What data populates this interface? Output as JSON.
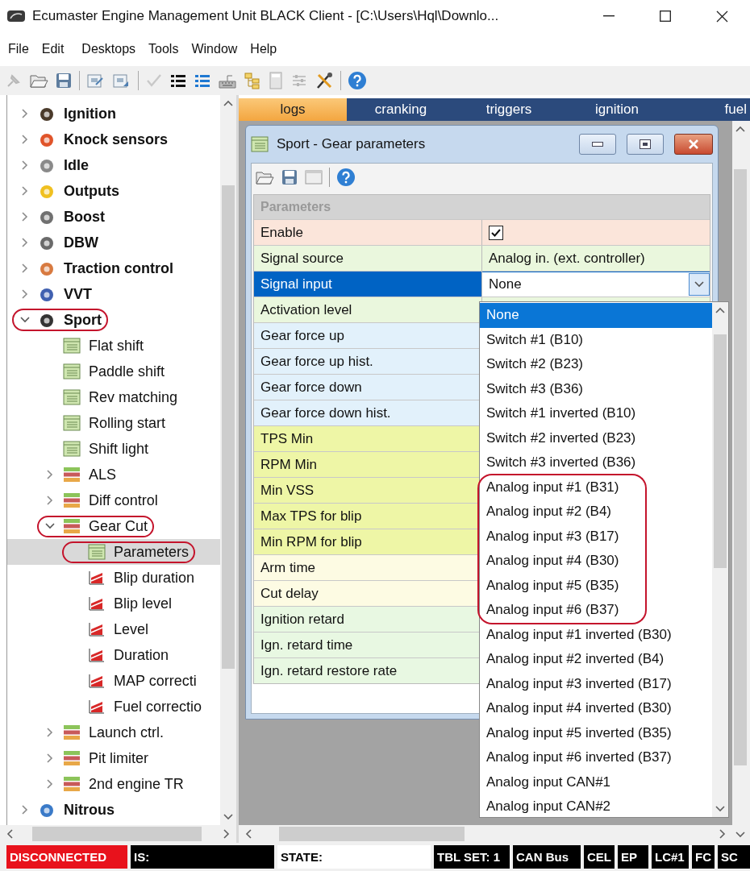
{
  "window": {
    "title": "Ecumaster Engine Management Unit BLACK Client - [C:\\Users\\Hql\\Downlo..."
  },
  "menu": [
    "File",
    "Edit",
    "Desktops",
    "Tools",
    "Window",
    "Help"
  ],
  "tree": {
    "items": [
      {
        "label": "Ignition",
        "kind": "category",
        "expanded": false,
        "selected": false,
        "circled": false
      },
      {
        "label": "Knock sensors",
        "kind": "category",
        "expanded": false,
        "selected": false,
        "circled": false
      },
      {
        "label": "Idle",
        "kind": "category",
        "expanded": false,
        "selected": false,
        "circled": false
      },
      {
        "label": "Outputs",
        "kind": "category",
        "expanded": false,
        "selected": false,
        "circled": false
      },
      {
        "label": "Boost",
        "kind": "category",
        "expanded": false,
        "selected": false,
        "circled": false
      },
      {
        "label": "DBW",
        "kind": "category",
        "expanded": false,
        "selected": false,
        "circled": false
      },
      {
        "label": "Traction control",
        "kind": "category",
        "expanded": false,
        "selected": false,
        "circled": false
      },
      {
        "label": "VVT",
        "kind": "category",
        "expanded": false,
        "selected": false,
        "circled": false
      },
      {
        "label": "Sport",
        "kind": "category",
        "expanded": true,
        "selected": false,
        "circled": true,
        "children": [
          {
            "label": "Flat shift",
            "kind": "table",
            "selected": false,
            "circled": false
          },
          {
            "label": "Paddle shift",
            "kind": "table",
            "selected": false,
            "circled": false
          },
          {
            "label": "Rev matching",
            "kind": "table",
            "selected": false,
            "circled": false
          },
          {
            "label": "Rolling start",
            "kind": "table",
            "selected": false,
            "circled": false
          },
          {
            "label": "Shift light",
            "kind": "table",
            "selected": false,
            "circled": false
          },
          {
            "label": "ALS",
            "kind": "group",
            "expanded": false,
            "selected": false,
            "circled": false
          },
          {
            "label": "Diff control",
            "kind": "group",
            "expanded": false,
            "selected": false,
            "circled": false
          },
          {
            "label": "Gear Cut",
            "kind": "group",
            "expanded": true,
            "selected": false,
            "circled": true,
            "children": [
              {
                "label": "Parameters",
                "kind": "table",
                "selected": true,
                "circled": true
              },
              {
                "label": "Blip duration",
                "kind": "map",
                "selected": false,
                "circled": false
              },
              {
                "label": "Blip level",
                "kind": "map",
                "selected": false,
                "circled": false
              },
              {
                "label": "Level",
                "kind": "map",
                "selected": false,
                "circled": false
              },
              {
                "label": "Duration",
                "kind": "map",
                "selected": false,
                "circled": false
              },
              {
                "label": "MAP correcti",
                "kind": "map",
                "selected": false,
                "circled": false
              },
              {
                "label": "Fuel correctio",
                "kind": "map",
                "selected": false,
                "circled": false
              }
            ]
          },
          {
            "label": "Launch ctrl.",
            "kind": "group",
            "expanded": false,
            "selected": false,
            "circled": false
          },
          {
            "label": "Pit limiter",
            "kind": "group",
            "expanded": false,
            "selected": false,
            "circled": false
          },
          {
            "label": "2nd engine TR",
            "kind": "group",
            "expanded": false,
            "selected": false,
            "circled": false
          }
        ]
      },
      {
        "label": "Nitrous",
        "kind": "category",
        "expanded": false,
        "selected": false,
        "circled": false
      }
    ]
  },
  "tabs": [
    {
      "label": "logs",
      "selected": true
    },
    {
      "label": "cranking",
      "selected": false
    },
    {
      "label": "triggers",
      "selected": false
    },
    {
      "label": "ignition",
      "selected": false
    },
    {
      "label": "fuel",
      "selected": false
    }
  ],
  "param_window": {
    "title": "Sport - Gear parameters",
    "section": "Parameters",
    "rows": [
      {
        "label": "Enable",
        "kind": "checkbox",
        "checked": true,
        "color": "#fbe5da",
        "selected": false
      },
      {
        "label": "Signal source",
        "kind": "text",
        "value": "Analog in. (ext. controller)",
        "color": "#eaf7dd",
        "selected": false
      },
      {
        "label": "Signal input",
        "kind": "dropdown",
        "value": "None",
        "selected": true
      },
      {
        "label": "Activation level",
        "kind": "empty",
        "color": "#eaf7dd",
        "selected": false
      },
      {
        "label": "Gear force up",
        "kind": "empty",
        "color": "#e2f1fb",
        "selected": false
      },
      {
        "label": "Gear force up hist.",
        "kind": "empty",
        "color": "#e2f1fb",
        "selected": false
      },
      {
        "label": "Gear force down",
        "kind": "empty",
        "color": "#e2f1fb",
        "selected": false
      },
      {
        "label": "Gear force down hist.",
        "kind": "empty",
        "color": "#e2f1fb",
        "selected": false
      },
      {
        "label": "TPS Min",
        "kind": "empty",
        "color": "#eef6a6",
        "selected": false
      },
      {
        "label": "RPM Min",
        "kind": "empty",
        "color": "#eef6a6",
        "selected": false
      },
      {
        "label": "Min VSS",
        "kind": "empty",
        "color": "#eef6a6",
        "selected": false
      },
      {
        "label": "Max TPS for blip",
        "kind": "empty",
        "color": "#eef6a6",
        "selected": false
      },
      {
        "label": "Min RPM for blip",
        "kind": "empty",
        "color": "#eef6a6",
        "selected": false
      },
      {
        "label": "Arm time",
        "kind": "empty",
        "color": "#fdfbe3",
        "selected": false
      },
      {
        "label": "Cut delay",
        "kind": "empty",
        "color": "#fdfbe3",
        "selected": false
      },
      {
        "label": "Ignition retard",
        "kind": "empty",
        "color": "#e8f8e2",
        "selected": false
      },
      {
        "label": "Ign. retard time",
        "kind": "empty",
        "color": "#e8f8e2",
        "selected": false
      },
      {
        "label": "Ign. retard restore rate",
        "kind": "empty",
        "color": "#e8f8e2",
        "selected": false
      }
    ]
  },
  "dropdown": {
    "options": [
      {
        "label": "None",
        "selected": true,
        "circled": false
      },
      {
        "label": "Switch #1 (B10)",
        "selected": false,
        "circled": false
      },
      {
        "label": "Switch #2 (B23)",
        "selected": false,
        "circled": false
      },
      {
        "label": "Switch #3 (B36)",
        "selected": false,
        "circled": false
      },
      {
        "label": "Switch #1 inverted (B10)",
        "selected": false,
        "circled": false
      },
      {
        "label": "Switch #2 inverted (B23)",
        "selected": false,
        "circled": false
      },
      {
        "label": "Switch #3 inverted (B36)",
        "selected": false,
        "circled": false
      },
      {
        "label": "Analog input #1 (B31)",
        "selected": false,
        "circled": true
      },
      {
        "label": "Analog input #2 (B4)",
        "selected": false,
        "circled": true
      },
      {
        "label": "Analog input #3 (B17)",
        "selected": false,
        "circled": true
      },
      {
        "label": "Analog input #4 (B30)",
        "selected": false,
        "circled": true
      },
      {
        "label": "Analog input #5 (B35)",
        "selected": false,
        "circled": true
      },
      {
        "label": "Analog input #6 (B37)",
        "selected": false,
        "circled": true
      },
      {
        "label": "Analog input #1 inverted (B30)",
        "selected": false,
        "circled": false
      },
      {
        "label": "Analog input #2 inverted (B4)",
        "selected": false,
        "circled": false
      },
      {
        "label": "Analog input #3 inverted (B17)",
        "selected": false,
        "circled": false
      },
      {
        "label": "Analog input #4 inverted (B30)",
        "selected": false,
        "circled": false
      },
      {
        "label": "Analog input #5 inverted (B35)",
        "selected": false,
        "circled": false
      },
      {
        "label": "Analog input #6 inverted (B37)",
        "selected": false,
        "circled": false
      },
      {
        "label": "Analog input CAN#1",
        "selected": false,
        "circled": false
      },
      {
        "label": "Analog input CAN#2",
        "selected": false,
        "circled": false
      }
    ]
  },
  "status_bar": [
    {
      "text": "DISCONNECTED",
      "color": "#e8121c"
    },
    {
      "text": "IS:",
      "color": "#000000"
    },
    {
      "text": "STATE:",
      "color": "#ffffff"
    },
    {
      "text": "TBL SET: 1",
      "color": "#000000"
    },
    {
      "text": "CAN Bus",
      "color": "#000000"
    },
    {
      "text": "CEL",
      "color": "#000000"
    },
    {
      "text": "EP",
      "color": "#000000"
    },
    {
      "text": "LC#1",
      "color": "#000000"
    },
    {
      "text": "FC",
      "color": "#000000"
    },
    {
      "text": "SC",
      "color": "#000000"
    }
  ]
}
